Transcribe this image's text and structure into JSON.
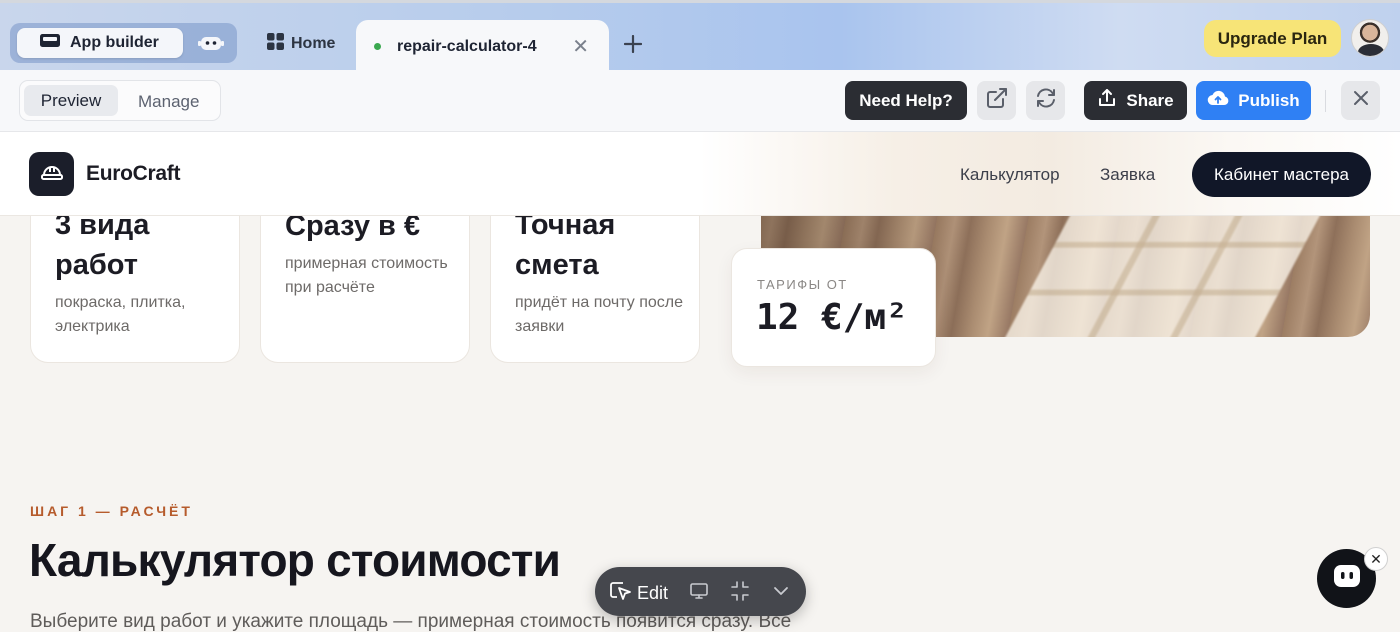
{
  "browser": {
    "app_builder_label": "App builder",
    "home_tab": "Home",
    "active_tab": "repair-calculator-4",
    "upgrade_label": "Upgrade Plan"
  },
  "toolbar": {
    "preview_label": "Preview",
    "manage_label": "Manage",
    "help_label": "Need Help?",
    "share_label": "Share",
    "publish_label": "Publish"
  },
  "site": {
    "brand": "EuroCraft",
    "nav": [
      "Калькулятор",
      "Заявка"
    ],
    "cta": "Кабинет мастера"
  },
  "features": [
    {
      "title": "3 вида работ",
      "subtitle": "покраска, плитка, электрика"
    },
    {
      "title": "Сразу в €",
      "subtitle": "примерная стоимость при расчёте"
    },
    {
      "title": "Точная смета",
      "subtitle": "придёт на почту после заявки"
    }
  ],
  "tariff": {
    "label": "ТАРИФЫ ОТ",
    "value": "12 €/м²"
  },
  "section": {
    "step": "ШАГ 1 — РАСЧЁТ",
    "title": "Калькулятор стоимости",
    "lead": "Выберите вид работ и укажите площадь — примерная стоимость появится сразу. Все"
  },
  "editbar": {
    "edit_label": "Edit"
  },
  "icons": [
    "monitor-icon",
    "bot-icon",
    "grid-icon",
    "close-icon",
    "plus-icon",
    "external-link-icon",
    "refresh-icon",
    "upload-icon",
    "cloud-upload-icon",
    "hard-hat-icon",
    "cursor-icon",
    "collapse-icon",
    "chevron-down-icon",
    "chat-bot-icon"
  ],
  "colors": {
    "publish": "#2f80f4",
    "upgrade": "#f7e477",
    "accent_step": "#b65b2c",
    "dark": "#111728"
  }
}
